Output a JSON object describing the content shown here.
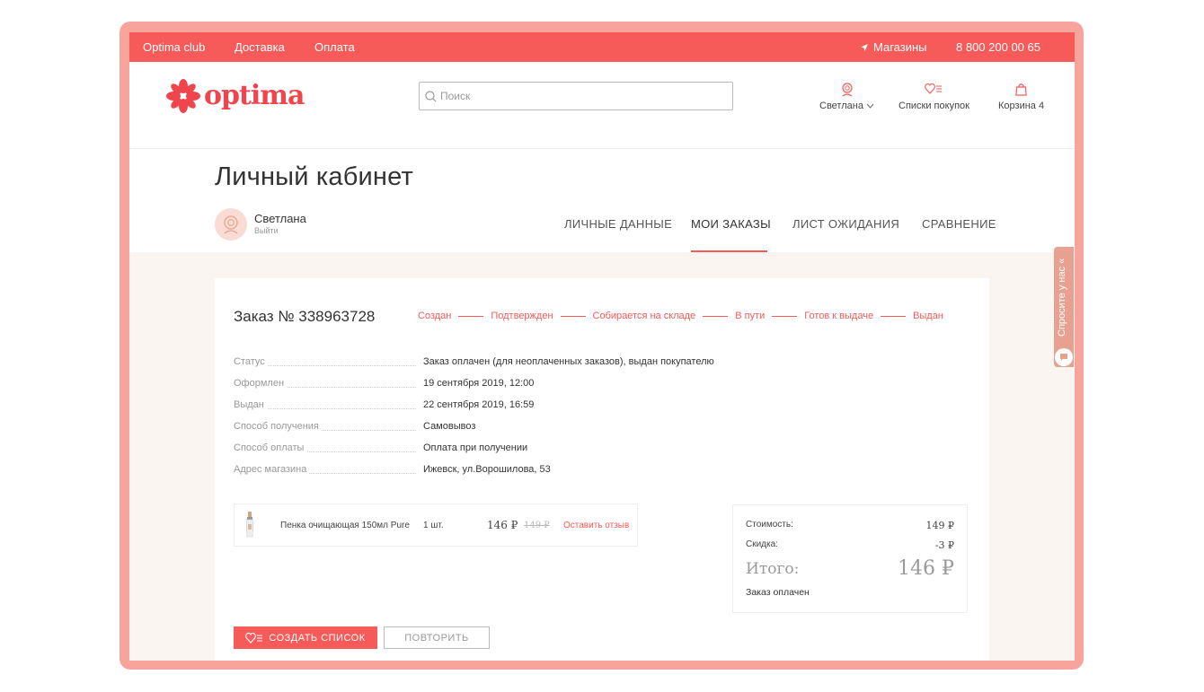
{
  "topbar": {
    "links": [
      "Optima club",
      "Доставка",
      "Оплата"
    ],
    "shops_label": "Магазины",
    "phone": "8 800 200 00 65"
  },
  "header": {
    "logo_text": "optima",
    "search_placeholder": "Поиск",
    "user_label": "Светлана",
    "lists_label": "Списки покупок",
    "cart_label": "Корзина 4"
  },
  "account": {
    "title": "Личный кабинет",
    "user_name": "Светлана",
    "logout": "Выйти",
    "tabs": [
      "ЛИЧНЫЕ ДАННЫЕ",
      "МОИ ЗАКАЗЫ",
      "ЛИСТ ОЖИДАНИЯ",
      "СРАВНЕНИЕ"
    ],
    "active_tab": "МОИ ЗАКАЗЫ"
  },
  "order": {
    "title": "Заказ № 338963728",
    "steps": [
      "Создан",
      "Подтвержден",
      "Собирается на складе",
      "В пути",
      "Готов к выдаче",
      "Выдан"
    ],
    "info": [
      {
        "key": "Статус",
        "value": "Заказ оплачен (для неоплаченных заказов), выдан покупателю"
      },
      {
        "key": "Оформлен",
        "value": "19 сентября 2019, 12:00"
      },
      {
        "key": "Выдан",
        "value": "22 сентября 2019, 16:59"
      },
      {
        "key": "Способ получения",
        "value": "Самовывоз"
      },
      {
        "key": "Способ оплаты",
        "value": "Оплата при получении"
      },
      {
        "key": "Адрес магазина",
        "value": "Ижевск, ул.Ворошилова, 53"
      }
    ],
    "item": {
      "name": "Пенка очищающая 150мл Pure",
      "qty": "1 шт.",
      "price": "146 ₽",
      "old_price": "149 ₽",
      "review_link": "Оставить отзыв"
    },
    "summary": {
      "cost_label": "Стоимость:",
      "cost_value": "149 ₽",
      "discount_label": "Скидка:",
      "discount_value": "-3 ₽",
      "total_label": "Итого:",
      "total_value": "146 ₽",
      "status": "Заказ оплачен"
    },
    "buttons": {
      "create_list": "СОЗДАТЬ СПИСОК",
      "repeat": "ПОВТОРИТЬ"
    }
  },
  "side_tab": {
    "label": "Спросите у нас «"
  },
  "colors": {
    "accent": "#f65a59",
    "frame": "#f7a59c",
    "content_bg": "#fbf5f2"
  }
}
